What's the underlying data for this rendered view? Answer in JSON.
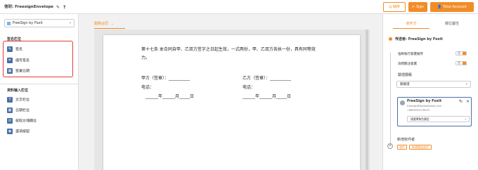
{
  "topbar": {
    "envelope_label": "信封: FreesignEnvelope",
    "save_label": "储存",
    "sign_label": "Sign",
    "total_label": "Total Account"
  },
  "left": {
    "signer": "FreeSign by Foxit",
    "signature_section": "签名栏位",
    "signature_items": [
      "签名",
      "缩写签名",
      "签署日期"
    ],
    "data_section": "资料输入栏位",
    "data_items": [
      "文字栏位",
      "日期栏位",
      "核取方塊欄位",
      "選項按鈕"
    ]
  },
  "center": {
    "doc_tab": "服務合同",
    "clause": "第十七条 本合同自甲、乙双方签字之日起生效，一式两份，甲、乙双方各执一份，具有同等效力。",
    "party_a": "甲方（签章）：__________",
    "party_b": "乙方（签章）：__________",
    "phone_a": "电话：",
    "phone_b": "电话：",
    "date_a": "______年______月_____日",
    "date_b": "______年______月_____日"
  },
  "right": {
    "tabs": [
      "收件方",
      "欄位屬性"
    ],
    "sender_label": "传送者: FreeSign by Foxit",
    "opt1_label": "強制執行簽署順序",
    "opt1_value": "否",
    "opt2_label": "詢問關注簽署",
    "opt2_value": "否",
    "level_label": "驗證層級",
    "level_value": "無驗證",
    "card_name": "FreeSign by Foxit",
    "card_email": "freesign@foxitsoftware.com",
    "card_phone": "+8860934578933",
    "card_role": "請選擇角色類型",
    "cc_label": "新增收件者",
    "chip1": "收件",
    "chip2": "新增電話收件"
  },
  "colors": {
    "accent": "#f28c28",
    "highlight_box": "#e53935",
    "icon_blue": "#4a6fa5"
  }
}
